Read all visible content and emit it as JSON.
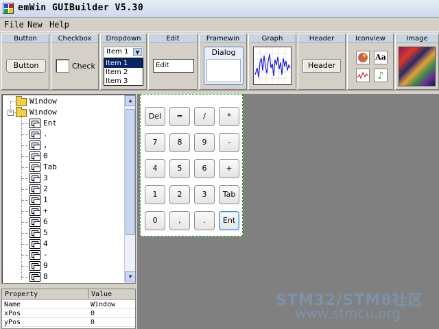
{
  "window": {
    "title": "emWin GUIBuilder V5.30"
  },
  "menu": {
    "file": "File",
    "new": "New",
    "help": "Help"
  },
  "toolbar": {
    "button": {
      "label": "Button",
      "caption": "Button"
    },
    "checkbox": {
      "label": "Checkbox",
      "caption": "Check"
    },
    "dropdown": {
      "label": "Dropdown",
      "selected": "Item 1",
      "items": [
        "Item 1",
        "Item 2",
        "Item 3"
      ]
    },
    "edit": {
      "label": "Edit",
      "value": "Edit"
    },
    "framewin": {
      "label": "Framewin",
      "caption": "Dialog"
    },
    "graph": {
      "label": "Graph"
    },
    "header": {
      "label": "Header",
      "caption": "Header"
    },
    "iconview": {
      "label": "Iconview",
      "icons": [
        "palette-icon",
        "font-icon",
        "waveform-icon",
        "music-note-icon"
      ],
      "font_glyph": "Aa",
      "music_glyph": "♪"
    },
    "image": {
      "label": "Image"
    }
  },
  "tree": {
    "root_items": [
      "Window",
      "Window"
    ],
    "children": [
      "Ent",
      ".",
      ",",
      "0",
      "Tab",
      "3",
      "2",
      "1",
      "+",
      "6",
      "5",
      "4",
      "-",
      "9",
      "8"
    ],
    "scroll_up": "▲",
    "scroll_down": "▼"
  },
  "properties": {
    "headers": [
      "Property",
      "Value"
    ],
    "rows": [
      {
        "name": "Name",
        "value": "Window"
      },
      {
        "name": "xPos",
        "value": "0"
      },
      {
        "name": "yPos",
        "value": "0"
      }
    ]
  },
  "calculator": {
    "rows": [
      [
        "Del",
        "=",
        "/",
        "*"
      ],
      [
        "7",
        "8",
        "9",
        "-"
      ],
      [
        "4",
        "5",
        "6",
        "+"
      ],
      [
        "1",
        "2",
        "3",
        "Tab"
      ],
      [
        "0",
        ",",
        ".",
        "Ent"
      ]
    ],
    "focused": "Ent"
  },
  "watermark": {
    "line1": "STM32/STM8社区",
    "line2": "www.stmcu.org"
  },
  "colors": {
    "selection": "#0a246a",
    "canvas": "#808080",
    "accent": "#2a9a2a"
  }
}
